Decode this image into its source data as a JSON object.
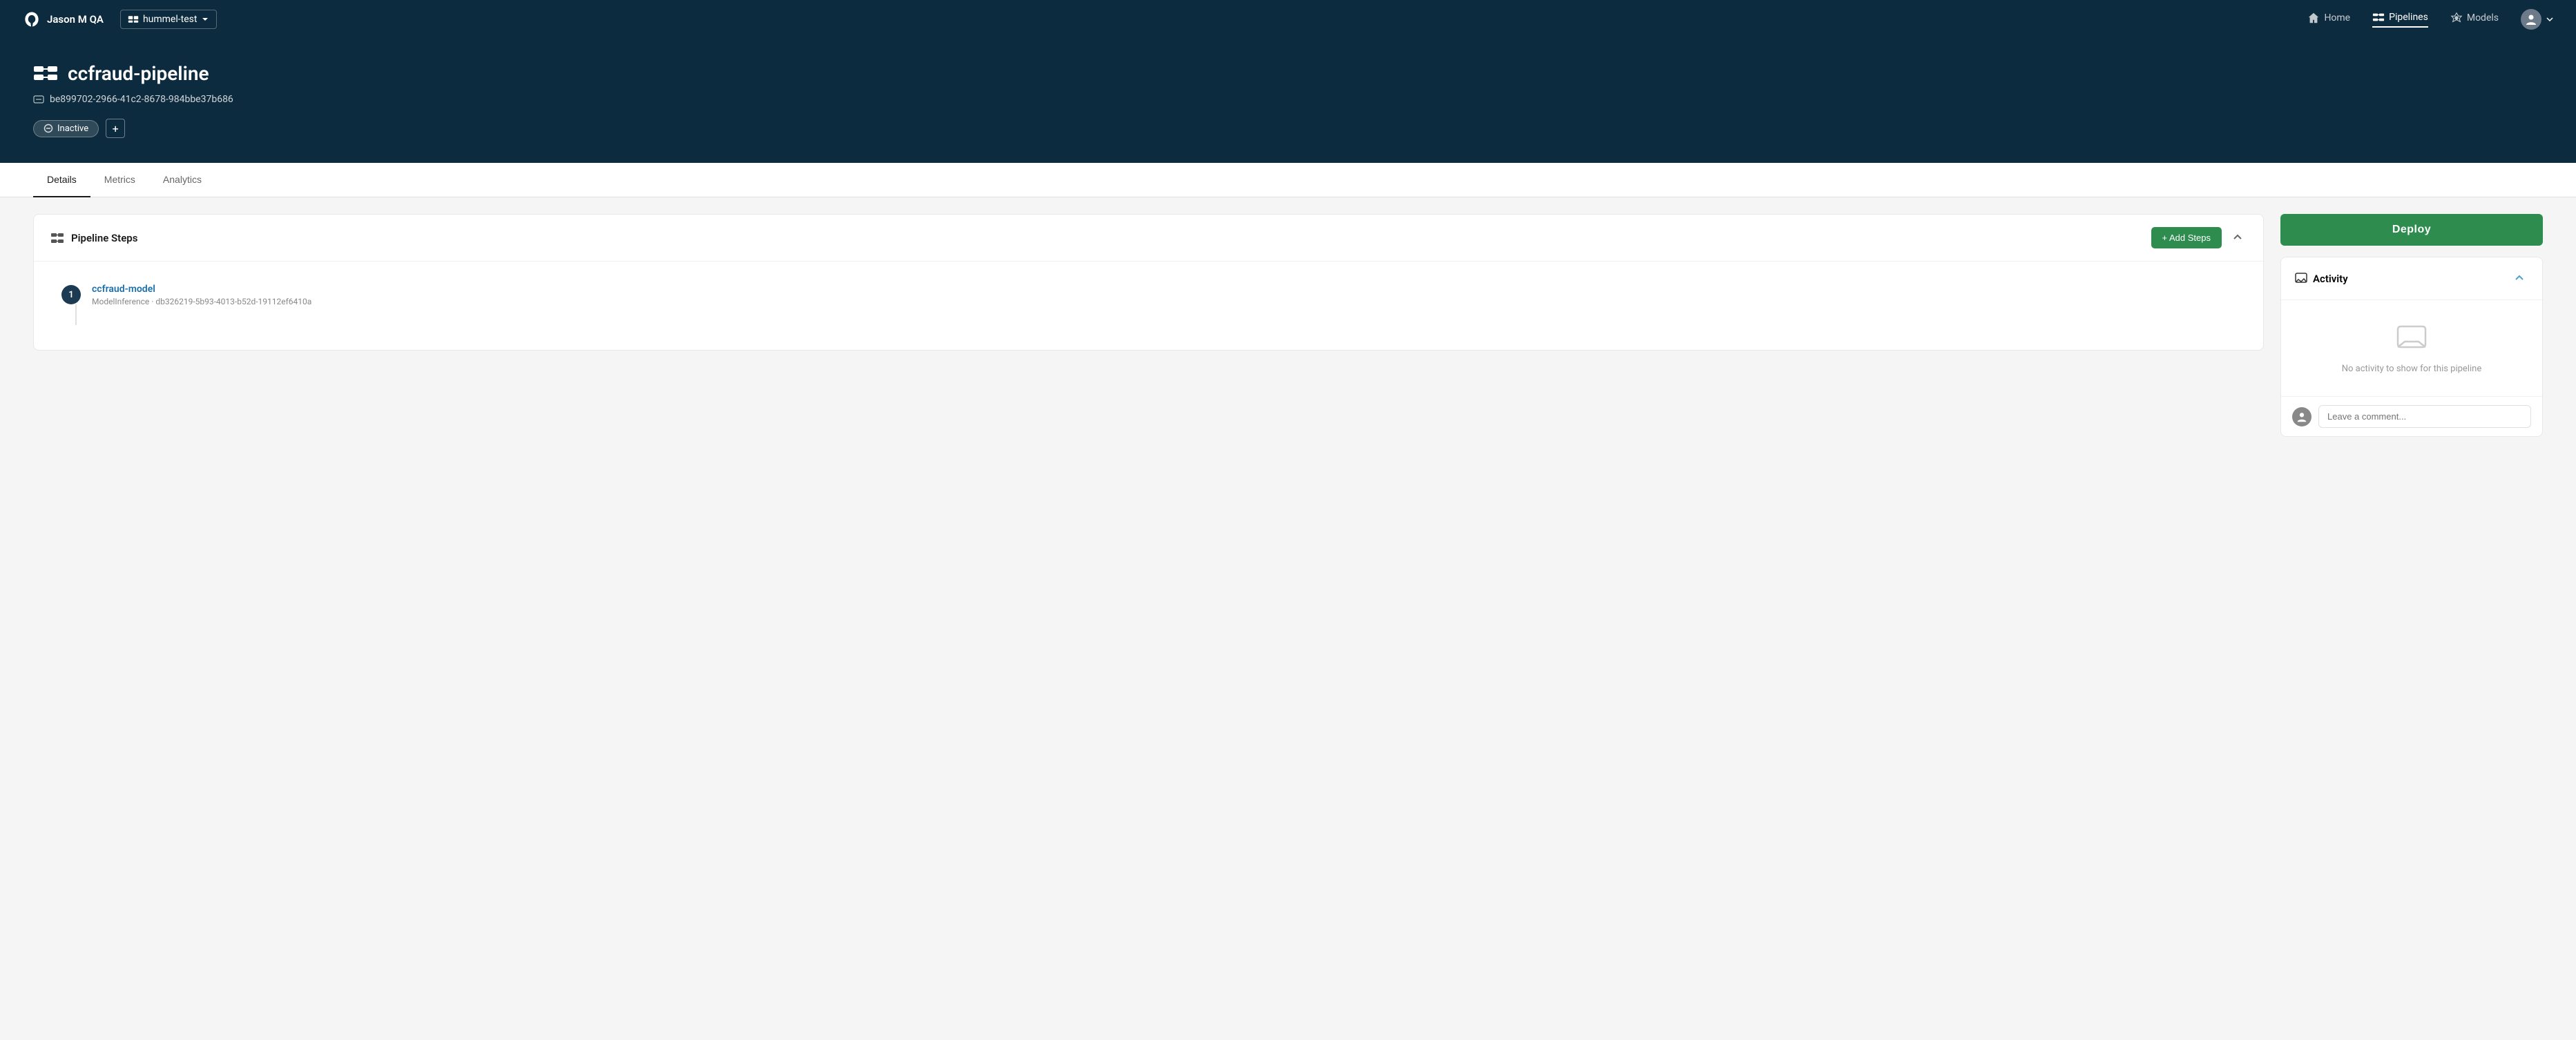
{
  "navbar": {
    "logo_alt": "Wallaroo",
    "user_label": "Jason M QA",
    "workspace_label": "hummel-test",
    "nav_home": "Home",
    "nav_pipelines": "Pipelines",
    "nav_models": "Models"
  },
  "hero": {
    "pipeline_name": "ccfraud-pipeline",
    "pipeline_id": "be899702-2966-41c2-8678-984bbe37b686",
    "status": "Inactive",
    "add_btn": "+"
  },
  "tabs": [
    {
      "id": "details",
      "label": "Details",
      "active": true
    },
    {
      "id": "metrics",
      "label": "Metrics",
      "active": false
    },
    {
      "id": "analytics",
      "label": "Analytics",
      "active": false
    }
  ],
  "pipeline_steps": {
    "title": "Pipeline Steps",
    "add_steps_btn": "+ Add Steps",
    "steps": [
      {
        "number": "1",
        "name": "ccfraud-model",
        "type": "ModelInference",
        "id": "db326219-5b93-4013-b52d-19112ef6410a"
      }
    ]
  },
  "right_panel": {
    "deploy_btn": "Deploy",
    "activity": {
      "title": "Activity",
      "empty_message": "No activity to show for this pipeline",
      "comment_placeholder": "Leave a comment..."
    }
  }
}
